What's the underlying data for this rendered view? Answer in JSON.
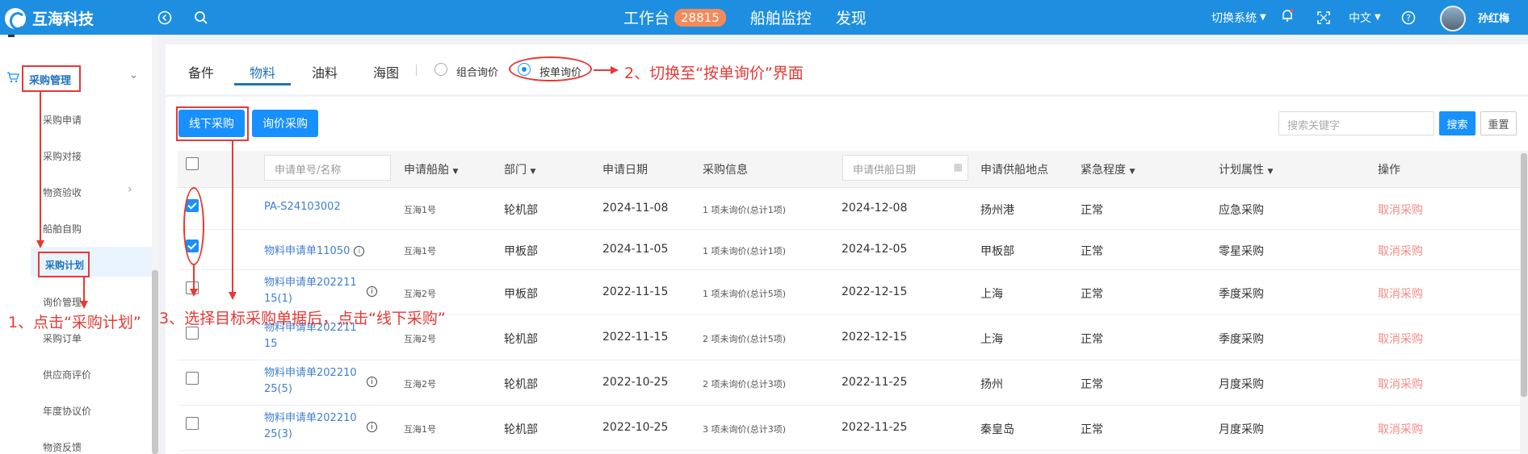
{
  "app": {
    "name": "互海科技"
  },
  "topnav": {
    "workbench": "工作台",
    "badge_count": "28815",
    "ship_monitor": "船舶监控",
    "discover": "发现",
    "switch_system": "切换系统",
    "language": "中文",
    "username": "孙红梅"
  },
  "sidebar": {
    "section": "采购管理",
    "items": [
      "采购申请",
      "采购对接",
      "物资验收",
      "船舶自购",
      "采购计划",
      "询价管理",
      "采购订单",
      "供应商评价",
      "年度协议价",
      "物资反馈"
    ]
  },
  "tabs": [
    "备件",
    "物料",
    "油料",
    "海图"
  ],
  "radios": {
    "combined": "组合询价",
    "single": "按单询价"
  },
  "buttons": {
    "offline": "线下采购",
    "inquiry": "询价采购",
    "search": "搜索",
    "reset": "重置"
  },
  "search": {
    "placeholder": "搜索关键字"
  },
  "table": {
    "headers": {
      "number_filter": "申请单号/名称",
      "ship": "申请船舶",
      "department": "部门",
      "apply_date": "申请日期",
      "purchase_info": "采购信息",
      "supply_date_filter": "申请供船日期",
      "supply_place": "申请供船地点",
      "urgency": "紧急程度",
      "plan_attr": "计划属性",
      "operation": "操作"
    },
    "rows": [
      {
        "no": "PA-S24103002",
        "ship": "互海1号",
        "dept": "轮机部",
        "date": "2024-11-08",
        "info": "1 项未询价(总计1项)",
        "supply_date": "2024-12-08",
        "place": "扬州港",
        "urgency": "正常",
        "plan": "应急采购",
        "op": "取消采购",
        "checked": true
      },
      {
        "no": "物料申请单11050",
        "ship": "互海1号",
        "dept": "甲板部",
        "date": "2024-11-05",
        "info": "1 项未询价(总计1项)",
        "supply_date": "2024-12-05",
        "place": "甲板部",
        "urgency": "正常",
        "plan": "零星采购",
        "op": "取消采购",
        "checked": true
      },
      {
        "no1": "物料申请单202211",
        "no2": "15(1)",
        "ship": "互海2号",
        "dept": "甲板部",
        "date": "2022-11-15",
        "info": "1 项未询价(总计5项)",
        "supply_date": "2022-12-15",
        "place": "上海",
        "urgency": "正常",
        "plan": "季度采购",
        "op": "取消采购",
        "checked": false
      },
      {
        "no1": "物料申请单202211",
        "no2": "15",
        "ship": "互海2号",
        "dept": "轮机部",
        "date": "2022-11-15",
        "info": "2 项未询价(总计5项)",
        "supply_date": "2022-12-15",
        "place": "上海",
        "urgency": "正常",
        "plan": "季度采购",
        "op": "取消采购",
        "checked": false
      },
      {
        "no1": "物料申请单202210",
        "no2": "25(5)",
        "ship": "互海2号",
        "dept": "轮机部",
        "date": "2022-10-25",
        "info": "2 项未询价(总计3项)",
        "supply_date": "2022-11-25",
        "place": "扬州",
        "urgency": "正常",
        "plan": "月度采购",
        "op": "取消采购",
        "checked": false
      },
      {
        "no1": "物料申请单202210",
        "no2": "25(3)",
        "ship": "互海1号",
        "dept": "轮机部",
        "date": "2022-10-25",
        "info": "3 项未询价(总计3项)",
        "supply_date": "2022-11-25",
        "place": "秦皇岛",
        "urgency": "正常",
        "plan": "月度采购",
        "op": "取消采购",
        "checked": false
      }
    ]
  },
  "annotations": {
    "step1": "1、点击“采购计划”",
    "step2": "2、切换至“按单询价”界面",
    "step3": "3、选择目标采购单据后，点击“线下采购”"
  }
}
